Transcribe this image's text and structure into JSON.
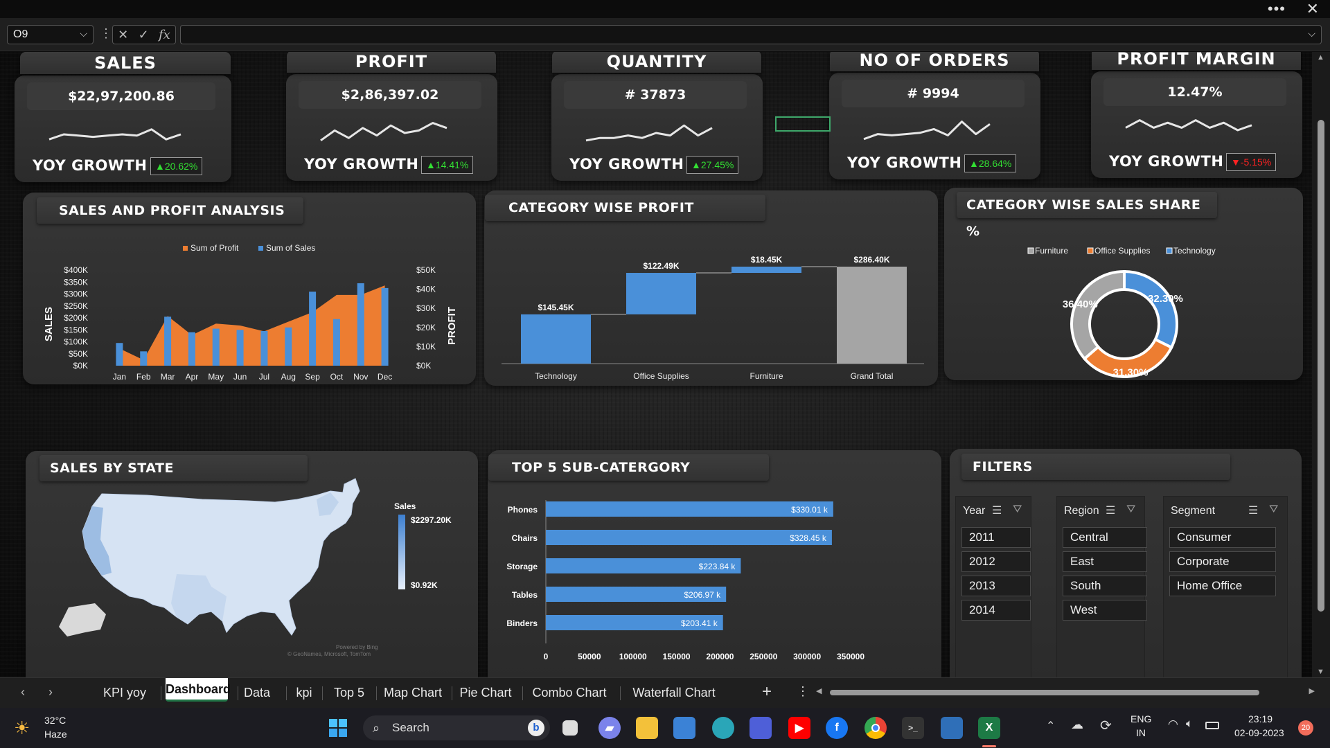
{
  "window": {
    "more_label": "•••",
    "close_label": "✕"
  },
  "formula_bar": {
    "name_box": "O9",
    "formula": "",
    "cancel_icon": "✕",
    "enter_icon": "✓",
    "fx_label": "fx"
  },
  "kpis": [
    {
      "title": "SALES",
      "value": "$22,97,200.86",
      "growth_label": "YOY GROWTH",
      "growth": "▲20.62%",
      "direction": "up"
    },
    {
      "title": "PROFIT",
      "value": "$2,86,397.02",
      "growth_label": "YOY GROWTH",
      "growth": "▲14.41%",
      "direction": "up"
    },
    {
      "title": "QUANTITY",
      "value": "# 37873",
      "growth_label": "YOY GROWTH",
      "growth": "▲27.45%",
      "direction": "up"
    },
    {
      "title": "NO OF ORDERS",
      "value": "# 9994",
      "growth_label": "YOY GROWTH",
      "growth": "▲28.64%",
      "direction": "up"
    },
    {
      "title": "PROFIT MARGIN",
      "value": "12.47%",
      "growth_label": "YOY GROWTH",
      "growth": "▼-5.15%",
      "direction": "down"
    }
  ],
  "panels": {
    "sales_profit": "SALES AND PROFIT ANALYSIS",
    "category_profit": "CATEGORY WISE PROFIT",
    "category_share": "CATEGORY WISE SALES SHARE %",
    "sales_by_state": "SALES BY STATE",
    "top5": "TOP 5 SUB-CATERGORY",
    "filters": "FILTERS"
  },
  "map": {
    "legend_title": "Sales",
    "legend_max": "$2297.20K",
    "legend_min": "$0.92K",
    "credit_1": "Powered by Bing",
    "credit_2": "© GeoNames, Microsoft, TomTom"
  },
  "filters": {
    "year": {
      "label": "Year",
      "items": [
        "2011",
        "2012",
        "2013",
        "2014"
      ]
    },
    "region": {
      "label": "Region",
      "items": [
        "Central",
        "East",
        "South",
        "West"
      ]
    },
    "segment": {
      "label": "Segment",
      "items": [
        "Consumer",
        "Corporate",
        "Home Office"
      ]
    }
  },
  "sheet_tabs": [
    "KPI yoy",
    "Dashboard",
    "Data",
    "kpi",
    "Top 5",
    "Map Chart",
    "Pie Chart",
    "Combo Chart",
    "Waterfall Chart"
  ],
  "active_sheet": "Dashboard",
  "taskbar": {
    "weather_temp": "32°C",
    "weather_desc": "Haze",
    "search": "Search",
    "lang_1": "ENG",
    "lang_2": "IN",
    "time": "23:19",
    "date": "02-09-2023",
    "notifications": "20"
  },
  "colors": {
    "accent_blue": "#4a90d9",
    "accent_orange": "#ed7d31",
    "accent_grey": "#a5a5a5",
    "up_green": "#33e033",
    "down_red": "#ff2222"
  },
  "chart_data": [
    {
      "type": "bar",
      "title": "SALES AND PROFIT ANALYSIS",
      "categories": [
        "Jan",
        "Feb",
        "Mar",
        "Apr",
        "May",
        "Jun",
        "Jul",
        "Aug",
        "Sep",
        "Oct",
        "Nov",
        "Dec"
      ],
      "series": [
        {
          "name": "Sum of Profit",
          "type": "area",
          "axis": "right",
          "values": [
            9000,
            3000,
            26000,
            16000,
            22000,
            21000,
            18000,
            23000,
            28000,
            37000,
            37000,
            42000
          ]
        },
        {
          "name": "Sum of Sales",
          "type": "bar",
          "axis": "left",
          "values": [
            95000,
            60000,
            205000,
            140000,
            155000,
            150000,
            145000,
            160000,
            310000,
            195000,
            345000,
            325000
          ]
        }
      ],
      "ylabel": "SALES",
      "y2label": "PROFIT",
      "yticks": [
        "$0K",
        "$50K",
        "$100K",
        "$150K",
        "$200K",
        "$250K",
        "$300K",
        "$350K",
        "$400K"
      ],
      "y2ticks": [
        "$0K",
        "$10K",
        "$20K",
        "$30K",
        "$40K",
        "$50K"
      ],
      "ylim": [
        0,
        400000
      ],
      "y2lim": [
        0,
        50000
      ],
      "legend": "top"
    },
    {
      "type": "bar",
      "subtype": "waterfall",
      "title": "CATEGORY WISE PROFIT",
      "categories": [
        "Technology",
        "Office Supplies",
        "Furniture",
        "Grand Total"
      ],
      "values": [
        145.45,
        122.49,
        18.45,
        286.4
      ],
      "labels": [
        "$145.45K",
        "$122.49K",
        "$18.45K",
        "$286.40K"
      ],
      "total_index": 3
    },
    {
      "type": "pie",
      "subtype": "donut",
      "title": "CATEGORY WISE SALES SHARE %",
      "categories": [
        "Technology",
        "Office Supplies",
        "Furniture"
      ],
      "values": [
        32.3,
        31.3,
        36.4
      ],
      "labels": [
        "32.30%",
        "31.30%",
        "36.40%"
      ],
      "legend_order": [
        "Furniture",
        "Office Supplies",
        "Technology"
      ],
      "legend": "top"
    },
    {
      "type": "bar",
      "orientation": "horizontal",
      "title": "TOP 5 SUB-CATERGORY",
      "categories": [
        "Phones",
        "Chairs",
        "Storage",
        "Tables",
        "Binders"
      ],
      "values": [
        330010,
        328450,
        223840,
        206970,
        203410
      ],
      "labels": [
        "$330.01 k",
        "$328.45 k",
        "$223.84 k",
        "$206.97 k",
        "$203.41 k"
      ],
      "xticks": [
        "0",
        "50000",
        "100000",
        "150000",
        "200000",
        "250000",
        "300000",
        "350000"
      ],
      "xlim": [
        0,
        350000
      ]
    }
  ]
}
